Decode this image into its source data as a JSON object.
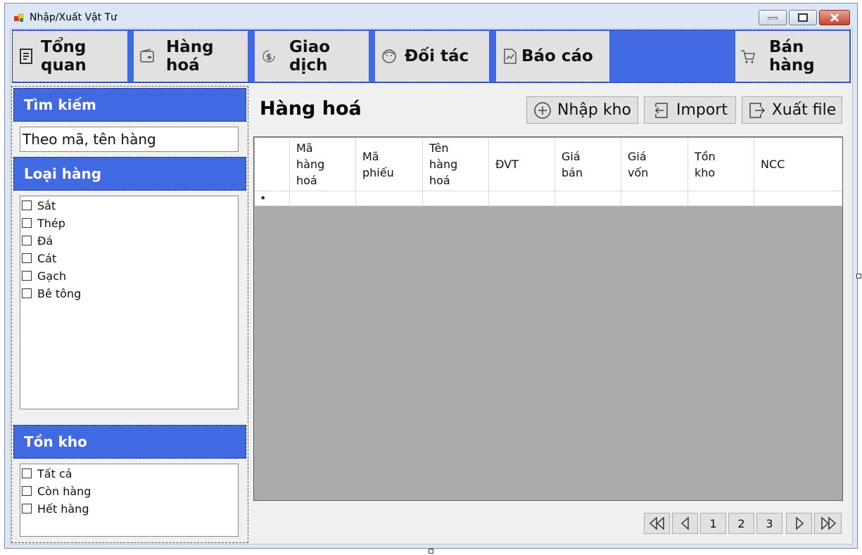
{
  "window": {
    "title": "Nhập/Xuất Vật Tư"
  },
  "nav": {
    "items": [
      {
        "label": "Tổng quan",
        "icon": "report-icon"
      },
      {
        "label": "Hàng hoá",
        "icon": "wallet-icon"
      },
      {
        "label": "Giao dịch",
        "icon": "dollar-cycle-icon"
      },
      {
        "label": "Đối tác",
        "icon": "face-icon"
      },
      {
        "label": "Báo cáo",
        "icon": "chart-report-icon"
      }
    ],
    "sell": {
      "label": "Bán hàng",
      "icon": "cart-icon"
    }
  },
  "sidebar": {
    "search": {
      "title": "Tìm kiếm",
      "value": "Theo mã, tên hàng"
    },
    "category": {
      "title": "Loại hàng",
      "options": [
        "Sắt",
        "Thép",
        "Đá",
        "Cát",
        "Gạch",
        "Bê tông"
      ]
    },
    "stock": {
      "title": "Tồn kho",
      "options": [
        "Tất cả",
        "Còn hàng",
        "Hết hàng"
      ]
    }
  },
  "main": {
    "title": "Hàng hoá",
    "actions": {
      "import_stock": "Nhập kho",
      "import": "Import",
      "export": "Xuất file"
    },
    "grid": {
      "columns": [
        "Mã\nhàng\nhoá",
        "Mã\nphiếu",
        "Tên\nhàng\nhoá",
        "ĐVT",
        "Giá\nbán",
        "Giá\nvốn",
        "Tồn\nkho",
        "NCC"
      ],
      "new_row_marker": "*"
    },
    "pagination": {
      "pages": [
        "1",
        "2",
        "3"
      ]
    }
  },
  "colors": {
    "accent": "#4169e1",
    "grid_background": "#ababab",
    "button": "#e1e1e1"
  }
}
